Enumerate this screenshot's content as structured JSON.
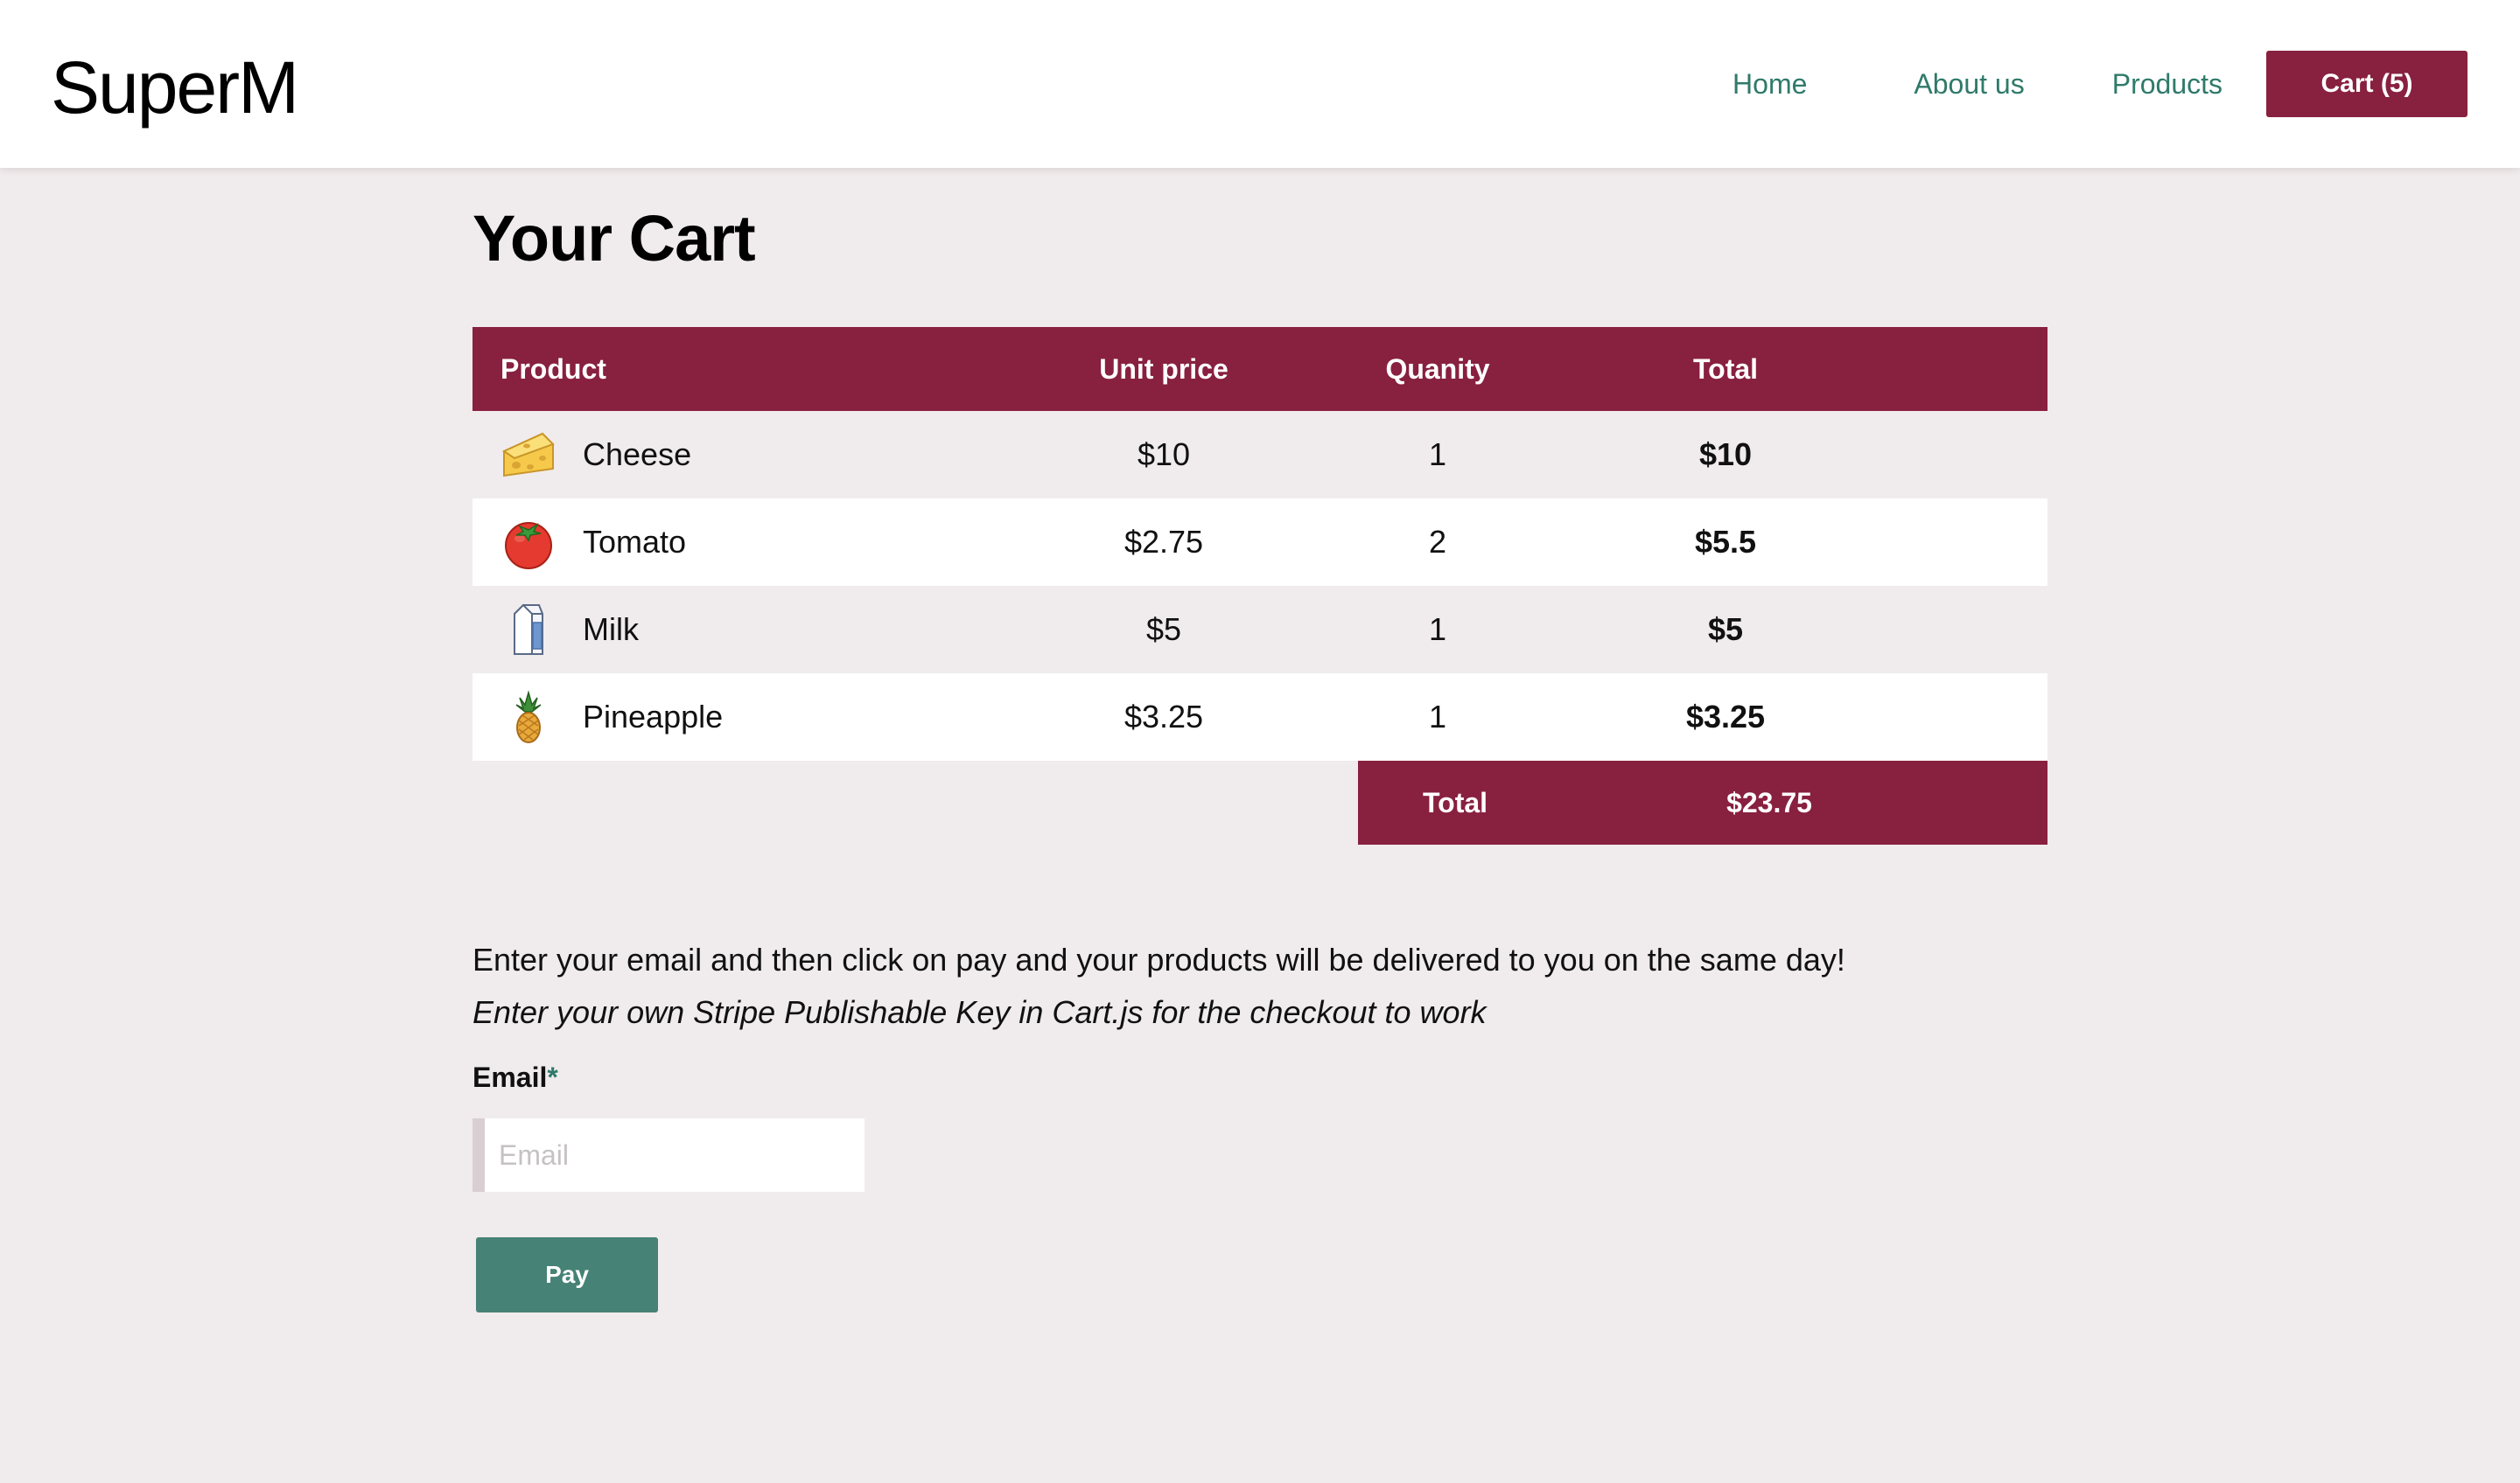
{
  "header": {
    "brand": "SuperM",
    "nav": {
      "home": "Home",
      "about": "About us",
      "products": "Products",
      "cart": "Cart (5)"
    }
  },
  "cart": {
    "title": "Your Cart",
    "columns": {
      "product": "Product",
      "unit_price": "Unit price",
      "quantity": "Quanity",
      "total": "Total"
    },
    "items": [
      {
        "name": "Cheese",
        "icon": "cheese-icon",
        "unit_price": "$10",
        "quantity": "1",
        "total": "$10"
      },
      {
        "name": "Tomato",
        "icon": "tomato-icon",
        "unit_price": "$2.75",
        "quantity": "2",
        "total": "$5.5"
      },
      {
        "name": "Milk",
        "icon": "milk-icon",
        "unit_price": "$5",
        "quantity": "1",
        "total": "$5"
      },
      {
        "name": "Pineapple",
        "icon": "pineapple-icon",
        "unit_price": "$3.25",
        "quantity": "1",
        "total": "$3.25"
      }
    ],
    "footer": {
      "label": "Total",
      "value": "$23.75"
    }
  },
  "checkout": {
    "info": "Enter your email and then click on pay and your products will be delivered to you on the same day!",
    "note": "Enter your own Stripe Publishable Key in Cart.js for the checkout to work",
    "email_label": "Email",
    "required_mark": "*",
    "email_placeholder": "Email",
    "email_value": "",
    "pay_label": "Pay"
  },
  "colors": {
    "brand": "#88203f",
    "accent": "#2f7a6a",
    "pay_button": "#468275",
    "background": "#f0ebec"
  }
}
